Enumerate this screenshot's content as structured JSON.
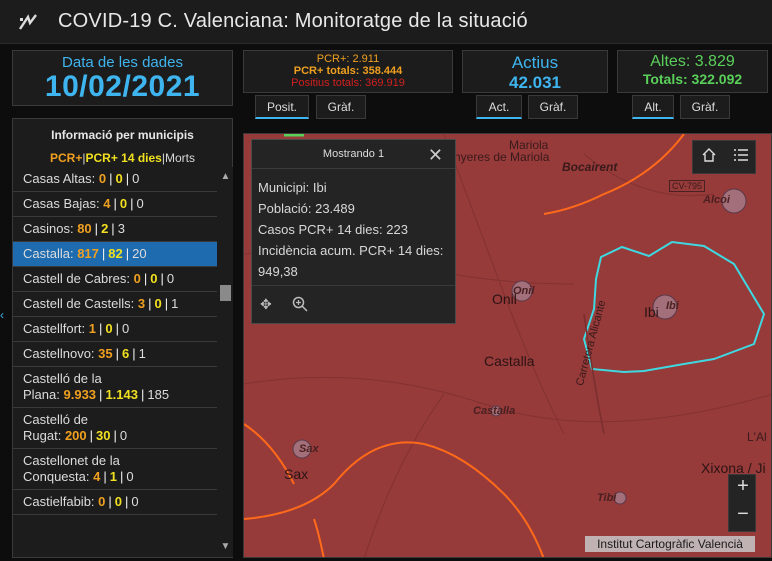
{
  "header": {
    "title": "COVID-19 C. Valenciana: Monitoratge de la situació",
    "logo_icon": "covid-logo-icon"
  },
  "date_panel": {
    "label": "Data de les dades",
    "value": "10/02/2021"
  },
  "pcr_panel": {
    "line1": "PCR+: 2.911",
    "line2": "PCR+ totals: 358.444",
    "line3": "Positius totals: 369.919"
  },
  "actius_panel": {
    "label": "Actius",
    "value": "42.031"
  },
  "altes_panel": {
    "label": "Altes: 3.829",
    "value": "Totals: 322.092"
  },
  "tabs": {
    "posit": "Posit.",
    "graf1": "Gràf.",
    "act": "Act.",
    "graf2": "Gràf.",
    "alt": "Alt.",
    "graf3": "Gràf."
  },
  "municipis": {
    "heading": "Informació per municipis",
    "legend_pcr": "PCR+",
    "legend_pcr14": "PCR+ 14 dies",
    "legend_morts": "Morts",
    "separator": "|",
    "rows": [
      {
        "name": "Casas Altas:",
        "v1": "0",
        "v2": "0",
        "v3": "0"
      },
      {
        "name": "Casas Bajas:",
        "v1": "4",
        "v2": "0",
        "v3": "0"
      },
      {
        "name": "Casinos:",
        "v1": "80",
        "v2": "2",
        "v3": "3"
      },
      {
        "name": "Castalla:",
        "v1": "817",
        "v2": "82",
        "v3": "20"
      },
      {
        "name": "Castell de Cabres:",
        "v1": "0",
        "v2": "0",
        "v3": "0"
      },
      {
        "name": "Castell de Castells:",
        "v1": "3",
        "v2": "0",
        "v3": "1"
      },
      {
        "name": "Castellfort:",
        "v1": "1",
        "v2": "0",
        "v3": "0"
      },
      {
        "name": "Castellnovo:",
        "v1": "35",
        "v2": "6",
        "v3": "1"
      },
      {
        "name": "Castelló de la",
        "name2": "Plana:",
        "v1": "9.933",
        "v2": "1.143",
        "v3": "185"
      },
      {
        "name": "Castelló de",
        "name2": "Rugat:",
        "v1": "200",
        "v2": "30",
        "v3": "0"
      },
      {
        "name": "Castellonet de la",
        "name2": "Conquesta:",
        "v1": "4",
        "v2": "1",
        "v3": "0"
      },
      {
        "name": "Castielfabib:",
        "v1": "0",
        "v2": "0",
        "v3": "0"
      }
    ]
  },
  "popup": {
    "title": "Mostrando 1",
    "municipi": "Municipi: Ibi",
    "poblacio": "Població: 23.489",
    "casos": "Casos PCR+ 14 dies: 223",
    "incidencia": "Incidència acum. PCR+ 14 dies: 949,38"
  },
  "map": {
    "labels": {
      "mariola": "Mariola",
      "agres": "nyeres de Mariola",
      "bocairent": "Bocairent",
      "cv795": "CV-795",
      "alcoi": "Alcoi",
      "onil": "Onil",
      "onil_big": "Onil",
      "ibi": "Ibi",
      "ibi_big": "Ibi",
      "castalla": "Castalla",
      "castalla_it": "Castalla",
      "carretera": "Carretera Alicante",
      "sax": "Sax",
      "sax_big": "Sax",
      "lal": "L'Al",
      "xixona": "Xixona / Ji",
      "tibi": "Tibi"
    },
    "attribution": "Institut Cartogràfic Valencià",
    "fill_color": "#963a3a",
    "highlight_color": "#3fd8e0",
    "road_color": "#ff6a1a"
  }
}
